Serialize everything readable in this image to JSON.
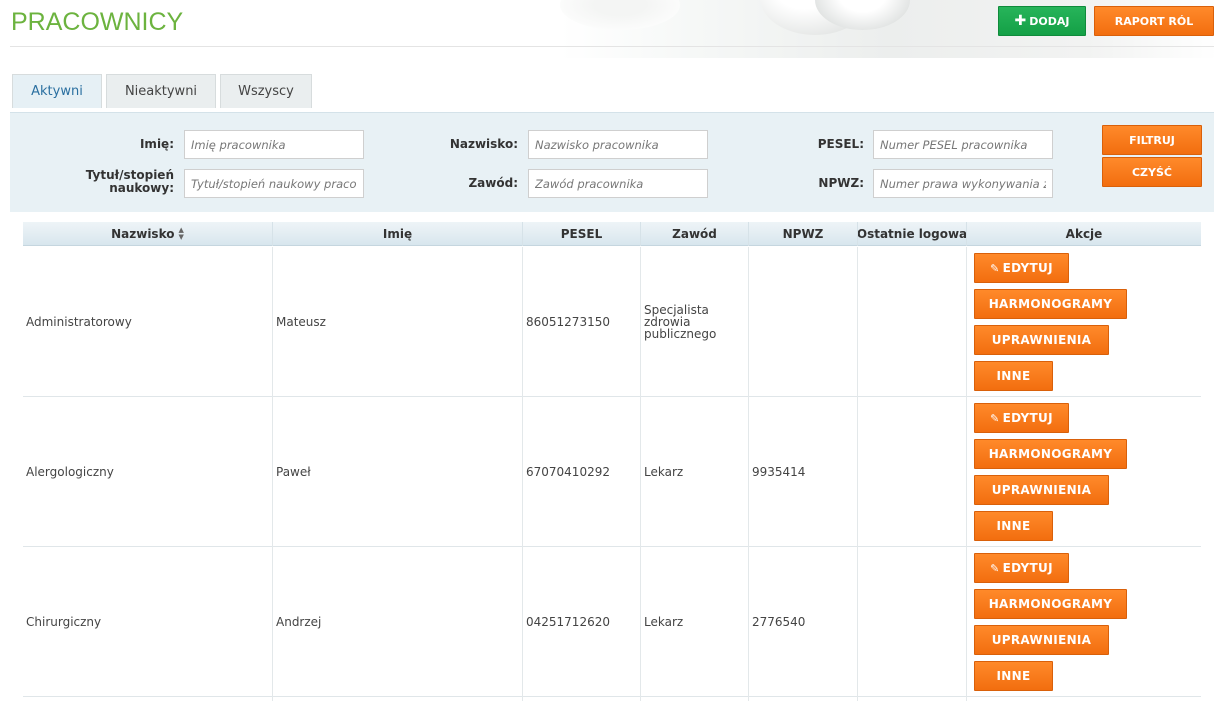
{
  "header": {
    "title": "PRACOWNICY",
    "add_label": "DODAJ",
    "raport_label": "RAPORT RÓL"
  },
  "tabs": [
    {
      "label": "Aktywni",
      "active": true
    },
    {
      "label": "Nieaktywni",
      "active": false
    },
    {
      "label": "Wszyscy",
      "active": false
    }
  ],
  "filters": {
    "imie_label": "Imię:",
    "imie_placeholder": "Imię pracownika",
    "nazwisko_label": "Nazwisko:",
    "nazwisko_placeholder": "Nazwisko pracownika",
    "pesel_label": "PESEL:",
    "pesel_placeholder": "Numer PESEL pracownika",
    "tytul_label_line1": "Tytuł/stopień",
    "tytul_label_line2": "naukowy:",
    "tytul_placeholder": "Tytuł/stopień naukowy pracownika",
    "zawod_label": "Zawód:",
    "zawod_placeholder": "Zawód pracownika",
    "npwz_label": "NPWZ:",
    "npwz_placeholder": "Numer prawa wykonywania zawodu",
    "filtruj_label": "FILTRUJ",
    "czysc_label": "CZYŚĆ"
  },
  "table": {
    "columns": [
      "Nazwisko",
      "Imię",
      "PESEL",
      "Zawód",
      "NPWZ",
      "Ostatnie logowa",
      "Akcje"
    ],
    "actions": {
      "edit": "EDYTUJ",
      "schedules": "HARMONOGRAMY",
      "permissions": "UPRAWNIENIA",
      "other": "INNE"
    },
    "rows": [
      {
        "nazwisko": "Administratorowy",
        "imie": "Mateusz",
        "pesel": "86051273150",
        "zawod_line1": "Specjalista",
        "zawod_line2": "zdrowia",
        "zawod_line3": "publicznego",
        "npwz": "",
        "last_login": ""
      },
      {
        "nazwisko": "Alergologiczny",
        "imie": "Paweł",
        "pesel": "67070410292",
        "zawod_line1": "Lekarz",
        "zawod_line2": "",
        "zawod_line3": "",
        "npwz": "9935414",
        "last_login": ""
      },
      {
        "nazwisko": "Chirurgiczny",
        "imie": "Andrzej",
        "pesel": "04251712620",
        "zawod_line1": "Lekarz",
        "zawod_line2": "",
        "zawod_line3": "",
        "npwz": "2776540",
        "last_login": ""
      }
    ]
  },
  "colors": {
    "title_green": "#6cb33f",
    "button_green": "#14a046",
    "button_orange": "#f26e0f",
    "filter_bg": "#e8f1f5"
  }
}
